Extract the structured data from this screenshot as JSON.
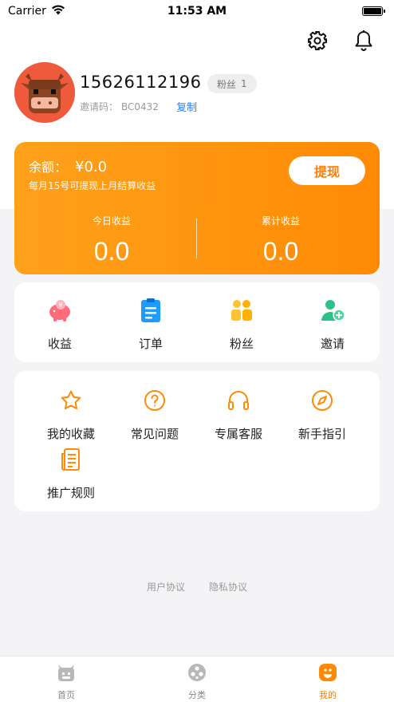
{
  "status_bar": {
    "carrier": "Carrier",
    "time": "11:53 AM"
  },
  "profile": {
    "phone": "15626112196",
    "fans_label": "粉丝",
    "fans_count": "1",
    "invite_label": "邀请码：",
    "invite_code": "BC0432",
    "copy_label": "复制"
  },
  "balance": {
    "label": "余额：",
    "amount": "¥0.0",
    "note": "每月15号可提现上月结算收益",
    "withdraw_label": "提现",
    "today_label": "今日收益",
    "today_value": "0.0",
    "total_label": "累计收益",
    "total_value": "0.0"
  },
  "quick_actions": [
    {
      "label": "收益",
      "icon": "piggy-bank-icon"
    },
    {
      "label": "订单",
      "icon": "clipboard-icon"
    },
    {
      "label": "粉丝",
      "icon": "people-icon"
    },
    {
      "label": "邀请",
      "icon": "add-user-icon"
    }
  ],
  "services": [
    {
      "label": "我的收藏",
      "icon": "star-icon"
    },
    {
      "label": "常见问题",
      "icon": "question-icon"
    },
    {
      "label": "专属客服",
      "icon": "headset-icon"
    },
    {
      "label": "新手指引",
      "icon": "compass-icon"
    },
    {
      "label": "推广规则",
      "icon": "document-icon"
    }
  ],
  "footer": {
    "user_agreement": "用户协议",
    "privacy_policy": "隐私协议"
  },
  "tabs": [
    {
      "label": "首页",
      "icon": "home-icon",
      "active": false
    },
    {
      "label": "分类",
      "icon": "category-icon",
      "active": false
    },
    {
      "label": "我的",
      "icon": "profile-icon",
      "active": true
    }
  ],
  "colors": {
    "accent": "#ff8a05",
    "link": "#2a7fff",
    "avatar_bg": "#f05a3c"
  }
}
